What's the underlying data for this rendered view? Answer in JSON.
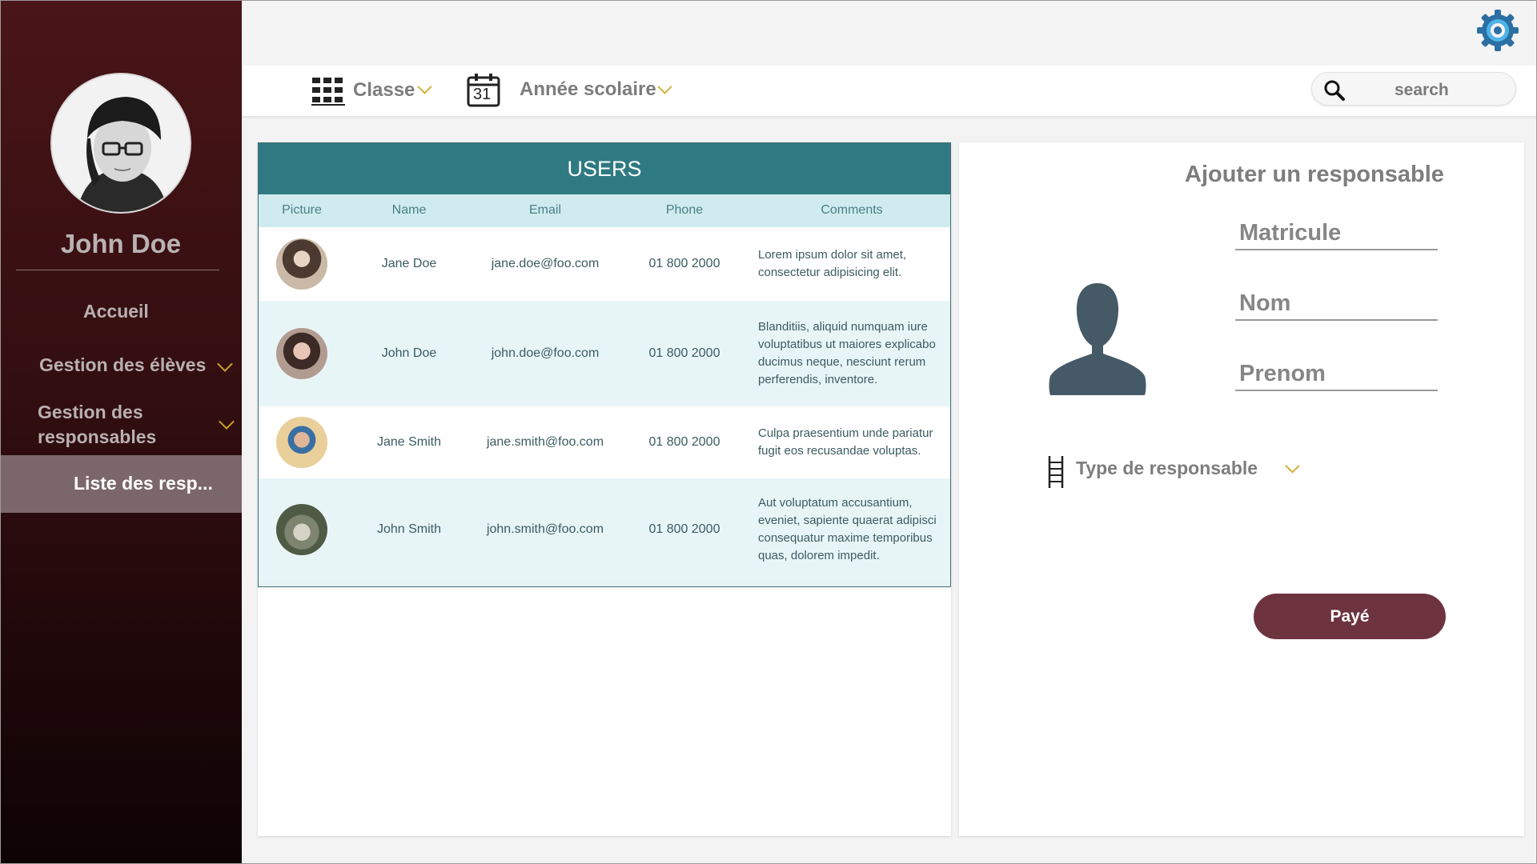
{
  "sidebar": {
    "user_name": "John Doe",
    "items": [
      {
        "label": "Accueil"
      },
      {
        "label": "Gestion des élèves"
      },
      {
        "label_line1": "Gestion des",
        "label_line2": "responsables"
      },
      {
        "label": "Liste des resp..."
      }
    ]
  },
  "toolbar": {
    "classe_label": "Classe",
    "annee_label": "Année scolaire",
    "calendar_day": "31",
    "search_placeholder": "search"
  },
  "users_table": {
    "title": "USERS",
    "columns": [
      "Picture",
      "Name",
      "Email",
      "Phone",
      "Comments"
    ],
    "rows": [
      {
        "name": "Jane Doe",
        "email": "jane.doe@foo.com",
        "phone": "01 800 2000",
        "comment": "Lorem ipsum dolor sit amet, consectetur adipisicing elit."
      },
      {
        "name": "John Doe",
        "email": "john.doe@foo.com",
        "phone": "01 800 2000",
        "comment": "Blanditiis, aliquid numquam iure voluptatibus ut maiores explicabo ducimus neque, nesciunt rerum perferendis, inventore."
      },
      {
        "name": "Jane Smith",
        "email": "jane.smith@foo.com",
        "phone": "01 800 2000",
        "comment": "Culpa praesentium unde pariatur fugit eos recusandae voluptas."
      },
      {
        "name": "John Smith",
        "email": "john.smith@foo.com",
        "phone": "01 800 2000",
        "comment": "Aut voluptatum accusantium, eveniet, sapiente quaerat adipisci consequatur maxime temporibus quas, dolorem impedit."
      }
    ]
  },
  "form": {
    "title": "Ajouter un responsable",
    "fields": {
      "matricule": "Matricule",
      "nom": "Nom",
      "prenom": "Prenom"
    },
    "type_label": "Type de  responsable",
    "submit_label": "Payé"
  },
  "colors": {
    "sidebar_top": "#4a1518",
    "table_header": "#2f7a82",
    "accent_chevron": "#d4b13d",
    "pay_button": "#6d3440"
  },
  "icons": [
    "gear-icon",
    "classroom-icon",
    "calendar-icon",
    "search-icon",
    "user-silhouette-icon",
    "list-icon",
    "chevron-down-icon"
  ]
}
